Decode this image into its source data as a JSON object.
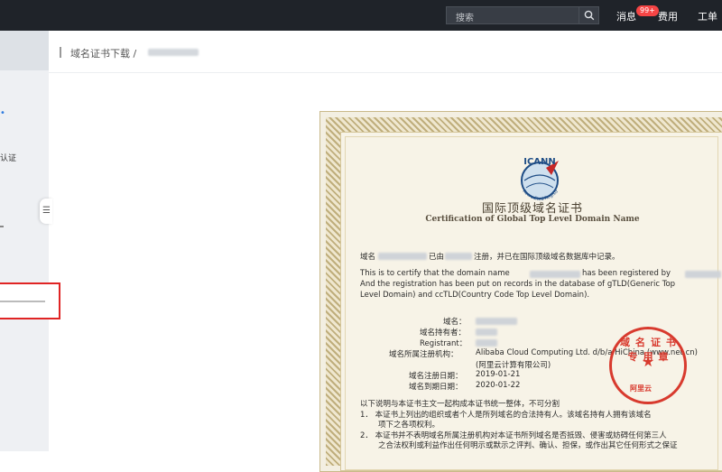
{
  "topbar": {
    "search_placeholder": "搜索",
    "messages_label": "消息",
    "messages_badge": "99+",
    "billing_label": "费用",
    "ticket_label": "工单"
  },
  "sidebar": {
    "item_fragment": "认证",
    "collapse_icon": "list-collapse-icon"
  },
  "breadcrumb": {
    "link": "域名证书下载",
    "separator": "/"
  },
  "certificate": {
    "title_cn": "国际顶级域名证书",
    "title_en": "Certification of Global Top Level Domain Name",
    "cn_intro_a": "域名",
    "cn_intro_b": "已由",
    "cn_intro_c": "注册，并已在国际顶级域名数据库中记录。",
    "en_line1_a": "This is to certify that the domain name",
    "en_line1_b": "has been registered by",
    "en_line2": "And the registration has been put on records in the database of gTLD(Generic Top",
    "en_line3": "Level Domain) and ccTLD(Country Code Top Level Domain).",
    "field_domain": "域名：",
    "field_holder": "域名持有者：",
    "field_registrant": "Registrant：",
    "field_registrar": "域名所属注册机构：",
    "registrar_value": "Alibaba Cloud Computing Ltd. d/b/a HiChina (www.net.cn)",
    "registrar_cn": "(阿里云计算有限公司)",
    "field_reg_date": "域名注册日期：",
    "reg_date": "2019-01-21",
    "field_exp_date": "域名到期日期：",
    "exp_date": "2020-01-22",
    "note_intro": "以下说明与本证书主文一起构成本证书统一整体，不可分割",
    "note1_a": "1．  本证书上列出的组织或者个人是所列域名的合法持有人。该域名持有人拥有该域名",
    "note1_b": "项下之各项权利。",
    "note2_a": "2．  本证书并不表明域名所属注册机构对本证书所列域名是否抵毁、侵害或妨碍任何第三人",
    "note2_b": "之合法权利或利益作出任何明示或默示之评判、确认、担保，或作出其它任何形式之保证",
    "stamp_text": "域名证书专用章",
    "stamp_brand": "阿里云",
    "logo_text": "ICANN",
    "logo_sub": "Accredited Registrar"
  }
}
